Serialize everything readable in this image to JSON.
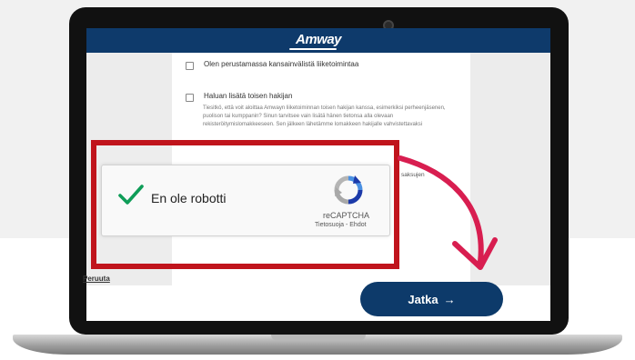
{
  "header": {
    "brand": "Amway"
  },
  "form": {
    "option_international": "Olen perustamassa kansainvälistä liiketoimintaa",
    "option_co_applicant": "Haluan lisätä toisen hakijan",
    "co_applicant_description": "Tiesitkö, että voit aloittaa Amwayn liiketoiminnan toisen hakijan kanssa, esimerkiksi perheenjäsenen, puolison tai kumppanin? Sinun tarvitsee vain lisätä hänen tietonsa alla olevaan rekisteröitymislomakkeeseen. Sen jälkeen lähetämme lomakkeen hakijalle vahvistettavaksi",
    "truncated_text": "saksujen"
  },
  "captcha": {
    "label": "En ole robotti",
    "brand": "reCAPTCHA",
    "links": "Tietosuoja - Ehdot",
    "checked": true
  },
  "footer": {
    "cancel_label": "Peruuta",
    "continue_label": "Jatka",
    "continue_arrow": "→"
  },
  "colors": {
    "brand_navy": "#0e3a6b",
    "highlight_red": "#c0141c",
    "arrow_pink": "#d81e50",
    "check_green": "#0f9d58"
  }
}
